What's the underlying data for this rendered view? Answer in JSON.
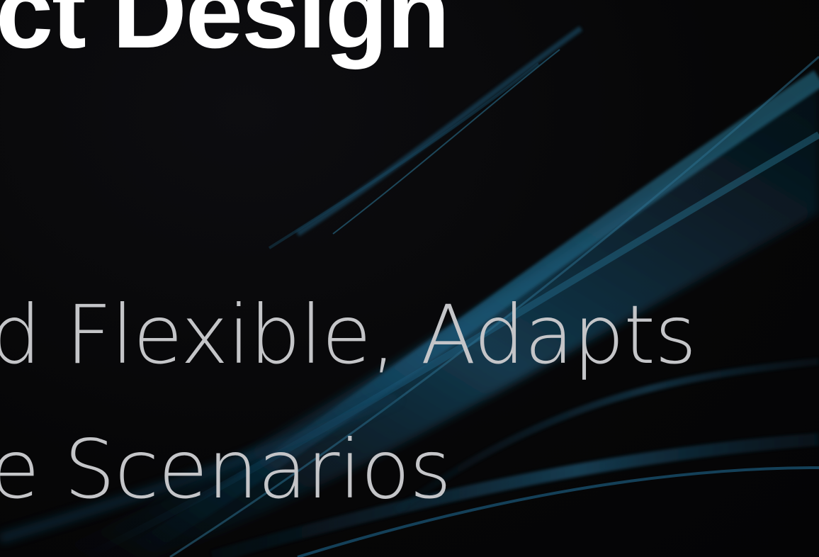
{
  "slide": {
    "heading": "ct Design",
    "subtitle_lines": [
      "d Flexible, Adapts",
      "e Scenarios"
    ]
  },
  "colors": {
    "background": "#060607",
    "heading_text": "#ffffff",
    "subtitle_text": "#c4c5c8",
    "wave_accent": "#1f5f80"
  }
}
